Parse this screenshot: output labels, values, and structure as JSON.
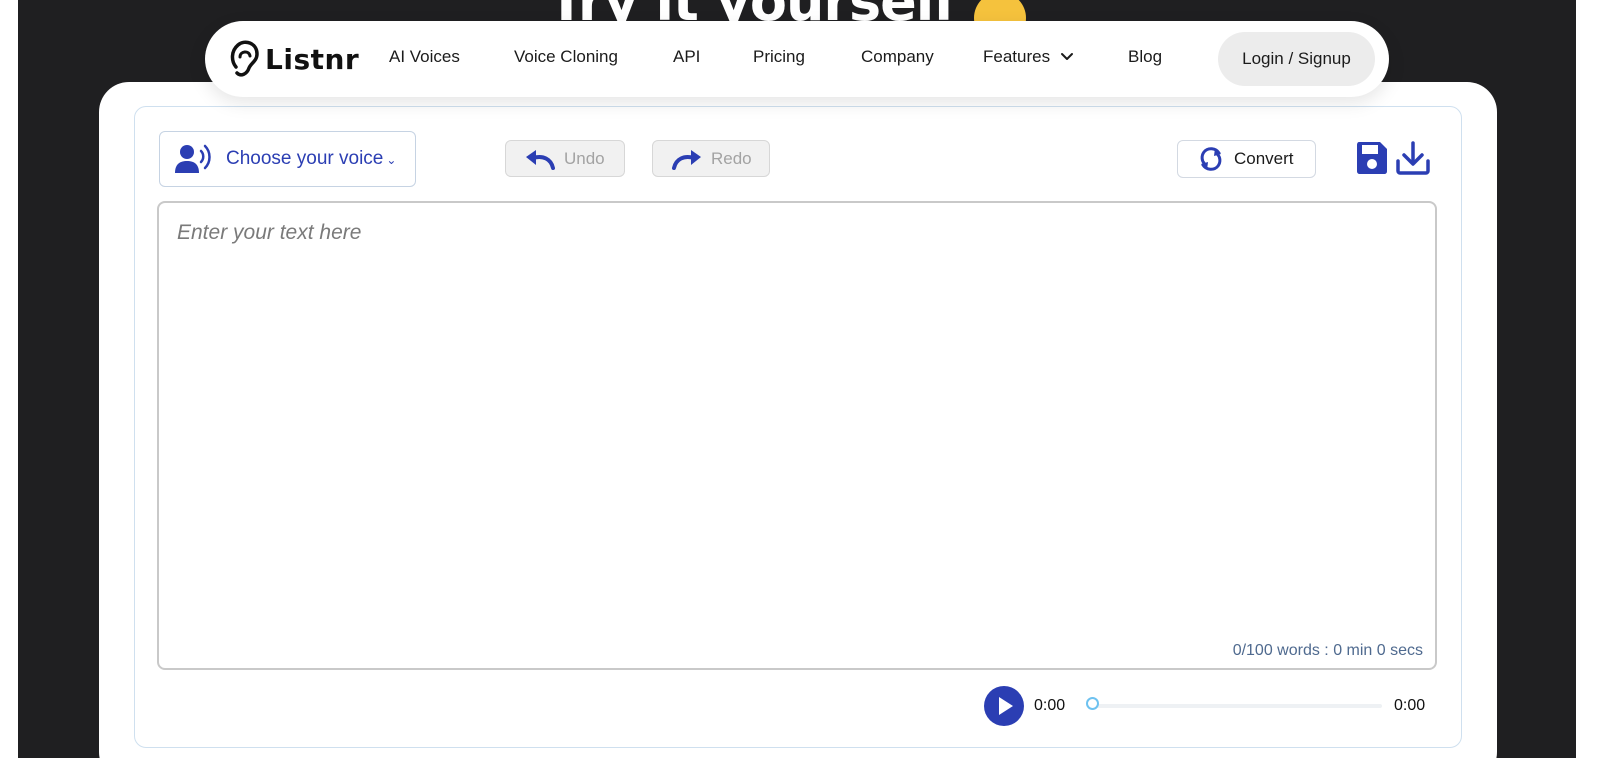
{
  "hero": {
    "title": "Try it yourself"
  },
  "nav": {
    "brand": "Listnr",
    "items": [
      {
        "label": "AI Voices"
      },
      {
        "label": "Voice Cloning"
      },
      {
        "label": "API"
      },
      {
        "label": "Pricing"
      },
      {
        "label": "Company"
      },
      {
        "label": "Features",
        "has_dropdown": true
      },
      {
        "label": "Blog"
      }
    ],
    "login_label": "Login / Signup"
  },
  "toolbar": {
    "voice_label": "Choose your voice",
    "undo_label": "Undo",
    "redo_label": "Redo",
    "convert_label": "Convert",
    "icons": [
      "voice-user-icon",
      "undo-icon",
      "redo-icon",
      "convert-icon",
      "save-icon",
      "download-icon"
    ]
  },
  "editor": {
    "placeholder": "Enter your text here",
    "value": "",
    "word_count": "0/100 words : 0 min 0 secs"
  },
  "player": {
    "current_time": "0:00",
    "duration": "0:00",
    "progress": 0
  },
  "colors": {
    "accent": "#2b3eb3",
    "dark_bg": "#1f1f21",
    "knob": "#6ec2f0",
    "count_text": "#4f6a8f"
  }
}
